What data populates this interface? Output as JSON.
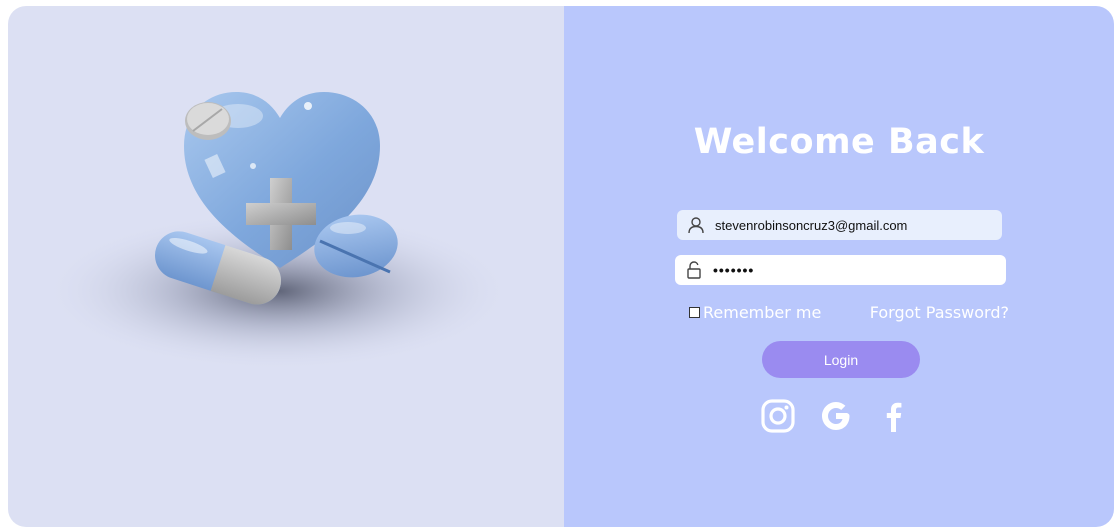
{
  "login": {
    "title": "Welcome Back",
    "email_value": "stevenrobinsoncruz3@gmail.com",
    "password_value": "•••••••",
    "remember_label": "Remember me",
    "forgot_label": "Forgot Password?",
    "login_label": "Login"
  },
  "icons": {
    "email": "user-icon",
    "password": "lock-icon",
    "socials": [
      "instagram-icon",
      "google-icon",
      "facebook-icon"
    ]
  },
  "colors": {
    "left_panel": "#dce0f3",
    "right_panel": "#b9c7fc",
    "button": "#9a8bf0",
    "text_light": "#ffffff"
  }
}
